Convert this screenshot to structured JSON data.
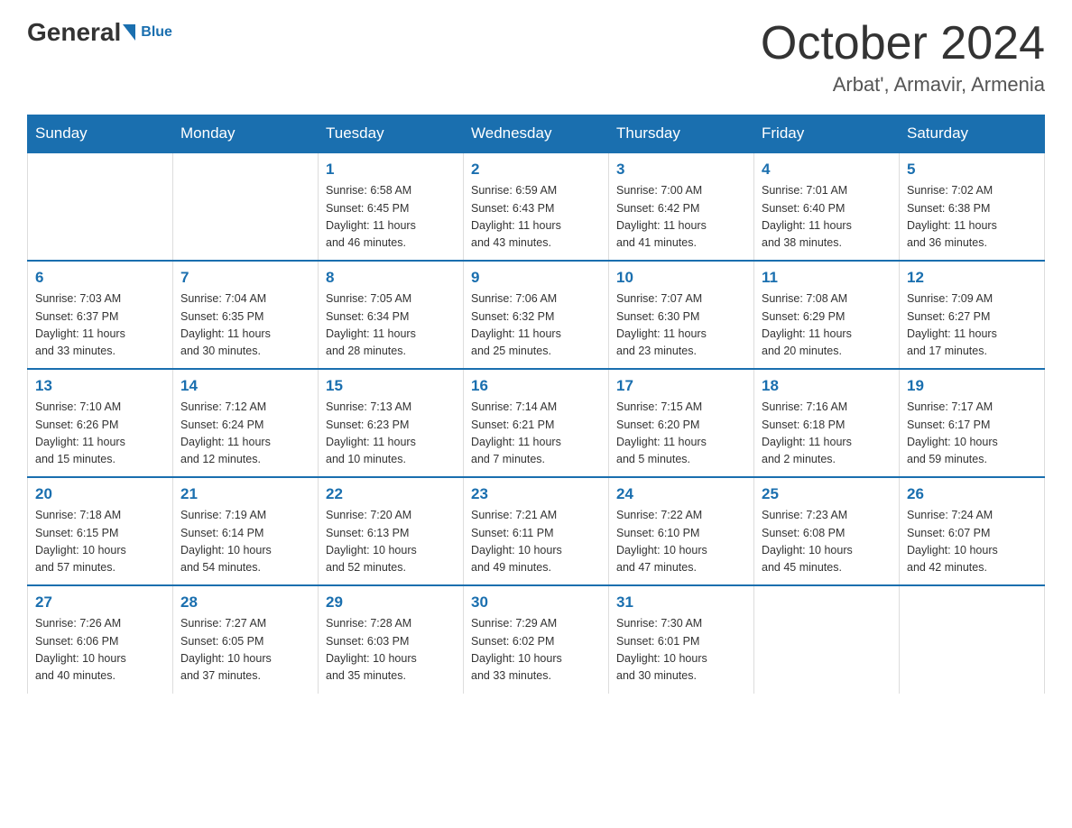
{
  "header": {
    "logo_general": "General",
    "logo_blue": "Blue",
    "month_title": "October 2024",
    "location": "Arbat', Armavir, Armenia"
  },
  "days_of_week": [
    "Sunday",
    "Monday",
    "Tuesday",
    "Wednesday",
    "Thursday",
    "Friday",
    "Saturday"
  ],
  "weeks": [
    [
      {
        "day": "",
        "info": ""
      },
      {
        "day": "",
        "info": ""
      },
      {
        "day": "1",
        "info": "Sunrise: 6:58 AM\nSunset: 6:45 PM\nDaylight: 11 hours\nand 46 minutes."
      },
      {
        "day": "2",
        "info": "Sunrise: 6:59 AM\nSunset: 6:43 PM\nDaylight: 11 hours\nand 43 minutes."
      },
      {
        "day": "3",
        "info": "Sunrise: 7:00 AM\nSunset: 6:42 PM\nDaylight: 11 hours\nand 41 minutes."
      },
      {
        "day": "4",
        "info": "Sunrise: 7:01 AM\nSunset: 6:40 PM\nDaylight: 11 hours\nand 38 minutes."
      },
      {
        "day": "5",
        "info": "Sunrise: 7:02 AM\nSunset: 6:38 PM\nDaylight: 11 hours\nand 36 minutes."
      }
    ],
    [
      {
        "day": "6",
        "info": "Sunrise: 7:03 AM\nSunset: 6:37 PM\nDaylight: 11 hours\nand 33 minutes."
      },
      {
        "day": "7",
        "info": "Sunrise: 7:04 AM\nSunset: 6:35 PM\nDaylight: 11 hours\nand 30 minutes."
      },
      {
        "day": "8",
        "info": "Sunrise: 7:05 AM\nSunset: 6:34 PM\nDaylight: 11 hours\nand 28 minutes."
      },
      {
        "day": "9",
        "info": "Sunrise: 7:06 AM\nSunset: 6:32 PM\nDaylight: 11 hours\nand 25 minutes."
      },
      {
        "day": "10",
        "info": "Sunrise: 7:07 AM\nSunset: 6:30 PM\nDaylight: 11 hours\nand 23 minutes."
      },
      {
        "day": "11",
        "info": "Sunrise: 7:08 AM\nSunset: 6:29 PM\nDaylight: 11 hours\nand 20 minutes."
      },
      {
        "day": "12",
        "info": "Sunrise: 7:09 AM\nSunset: 6:27 PM\nDaylight: 11 hours\nand 17 minutes."
      }
    ],
    [
      {
        "day": "13",
        "info": "Sunrise: 7:10 AM\nSunset: 6:26 PM\nDaylight: 11 hours\nand 15 minutes."
      },
      {
        "day": "14",
        "info": "Sunrise: 7:12 AM\nSunset: 6:24 PM\nDaylight: 11 hours\nand 12 minutes."
      },
      {
        "day": "15",
        "info": "Sunrise: 7:13 AM\nSunset: 6:23 PM\nDaylight: 11 hours\nand 10 minutes."
      },
      {
        "day": "16",
        "info": "Sunrise: 7:14 AM\nSunset: 6:21 PM\nDaylight: 11 hours\nand 7 minutes."
      },
      {
        "day": "17",
        "info": "Sunrise: 7:15 AM\nSunset: 6:20 PM\nDaylight: 11 hours\nand 5 minutes."
      },
      {
        "day": "18",
        "info": "Sunrise: 7:16 AM\nSunset: 6:18 PM\nDaylight: 11 hours\nand 2 minutes."
      },
      {
        "day": "19",
        "info": "Sunrise: 7:17 AM\nSunset: 6:17 PM\nDaylight: 10 hours\nand 59 minutes."
      }
    ],
    [
      {
        "day": "20",
        "info": "Sunrise: 7:18 AM\nSunset: 6:15 PM\nDaylight: 10 hours\nand 57 minutes."
      },
      {
        "day": "21",
        "info": "Sunrise: 7:19 AM\nSunset: 6:14 PM\nDaylight: 10 hours\nand 54 minutes."
      },
      {
        "day": "22",
        "info": "Sunrise: 7:20 AM\nSunset: 6:13 PM\nDaylight: 10 hours\nand 52 minutes."
      },
      {
        "day": "23",
        "info": "Sunrise: 7:21 AM\nSunset: 6:11 PM\nDaylight: 10 hours\nand 49 minutes."
      },
      {
        "day": "24",
        "info": "Sunrise: 7:22 AM\nSunset: 6:10 PM\nDaylight: 10 hours\nand 47 minutes."
      },
      {
        "day": "25",
        "info": "Sunrise: 7:23 AM\nSunset: 6:08 PM\nDaylight: 10 hours\nand 45 minutes."
      },
      {
        "day": "26",
        "info": "Sunrise: 7:24 AM\nSunset: 6:07 PM\nDaylight: 10 hours\nand 42 minutes."
      }
    ],
    [
      {
        "day": "27",
        "info": "Sunrise: 7:26 AM\nSunset: 6:06 PM\nDaylight: 10 hours\nand 40 minutes."
      },
      {
        "day": "28",
        "info": "Sunrise: 7:27 AM\nSunset: 6:05 PM\nDaylight: 10 hours\nand 37 minutes."
      },
      {
        "day": "29",
        "info": "Sunrise: 7:28 AM\nSunset: 6:03 PM\nDaylight: 10 hours\nand 35 minutes."
      },
      {
        "day": "30",
        "info": "Sunrise: 7:29 AM\nSunset: 6:02 PM\nDaylight: 10 hours\nand 33 minutes."
      },
      {
        "day": "31",
        "info": "Sunrise: 7:30 AM\nSunset: 6:01 PM\nDaylight: 10 hours\nand 30 minutes."
      },
      {
        "day": "",
        "info": ""
      },
      {
        "day": "",
        "info": ""
      }
    ]
  ]
}
